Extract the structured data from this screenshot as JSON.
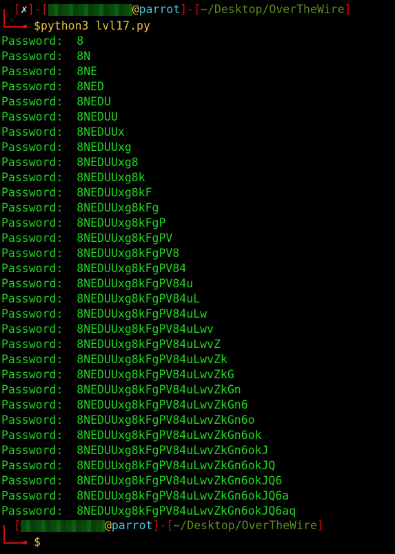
{
  "prompt_top": {
    "status": "✗",
    "host": "parrot",
    "at": "@",
    "path": "~/Desktop/OverTheWire",
    "dollar": "$",
    "command": "python3 lvl17.py"
  },
  "output_label": "Password:",
  "output": [
    "8",
    "8N",
    "8NE",
    "8NED",
    "8NEDU",
    "8NEDUU",
    "8NEDUUx",
    "8NEDUUxg",
    "8NEDUUxg8",
    "8NEDUUxg8k",
    "8NEDUUxg8kF",
    "8NEDUUxg8kFg",
    "8NEDUUxg8kFgP",
    "8NEDUUxg8kFgPV",
    "8NEDUUxg8kFgPV8",
    "8NEDUUxg8kFgPV84",
    "8NEDUUxg8kFgPV84u",
    "8NEDUUxg8kFgPV84uL",
    "8NEDUUxg8kFgPV84uLw",
    "8NEDUUxg8kFgPV84uLwv",
    "8NEDUUxg8kFgPV84uLwvZ",
    "8NEDUUxg8kFgPV84uLwvZk",
    "8NEDUUxg8kFgPV84uLwvZkG",
    "8NEDUUxg8kFgPV84uLwvZkGn",
    "8NEDUUxg8kFgPV84uLwvZkGn6",
    "8NEDUUxg8kFgPV84uLwvZkGn6o",
    "8NEDUUxg8kFgPV84uLwvZkGn6ok",
    "8NEDUUxg8kFgPV84uLwvZkGn6okJ",
    "8NEDUUxg8kFgPV84uLwvZkGn6okJQ",
    "8NEDUUxg8kFgPV84uLwvZkGn6okJQ6",
    "8NEDUUxg8kFgPV84uLwvZkGn6okJQ6a",
    "8NEDUUxg8kFgPV84uLwvZkGn6okJQ6aq"
  ],
  "prompt_bottom": {
    "host": "parrot",
    "at": "@",
    "path": "~/Desktop/OverTheWire",
    "dollar": "$"
  },
  "colors": {
    "background": "#000000",
    "output": "#1ed81e",
    "bracket": "#d01010",
    "host": "#4fc4e0",
    "path": "#5a8e1a",
    "command": "#e8c43a"
  }
}
